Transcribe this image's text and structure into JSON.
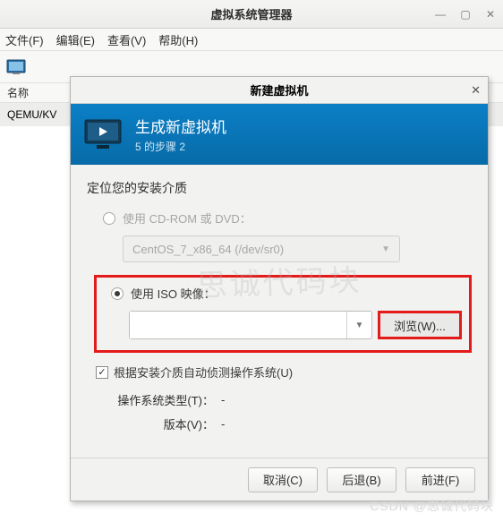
{
  "window": {
    "title": "虚拟系统管理器"
  },
  "menu": {
    "file": "文件(F)",
    "edit": "编辑(E)",
    "view": "查看(V)",
    "help": "帮助(H)"
  },
  "sidebar": {
    "header": "名称",
    "item": "QEMU/KV"
  },
  "dialog": {
    "title": "新建虚拟机",
    "banner_title": "生成新虚拟机",
    "banner_sub": "5 的步骤 2",
    "locate_label": "定位您的安装介质",
    "radio_cdrom": "使用 CD-ROM 或 DVD：",
    "cdrom_value": "CentOS_7_x86_64 (/dev/sr0)",
    "radio_iso": "使用 ISO 映像：",
    "iso_value": "",
    "browse": "浏览(W)...",
    "autodetect": "根据安装介质自动侦测操作系统(U)",
    "ostype_label": "操作系统类型(T)：",
    "ostype_value": "-",
    "version_label": "版本(V)：",
    "version_value": "-",
    "cancel": "取消(C)",
    "back": "后退(B)",
    "forward": "前进(F)"
  },
  "watermark": "CSDN @思诚代码块",
  "overlay": "思诚代码块"
}
